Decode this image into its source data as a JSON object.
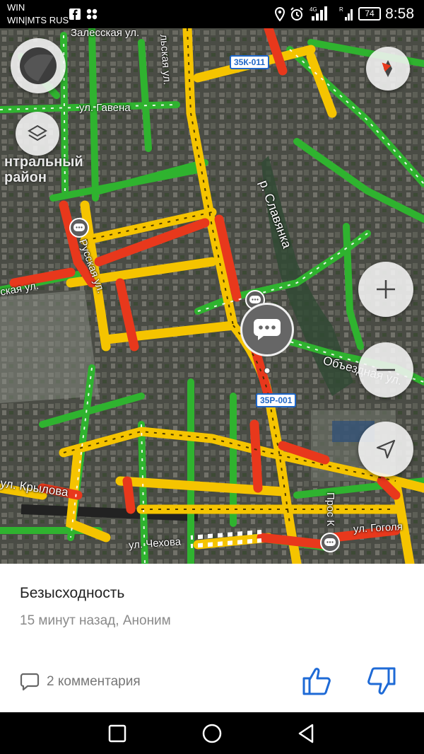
{
  "status_bar": {
    "carrier_line1": "WIN",
    "carrier_line2": "WIN|MTS RUS",
    "time": "8:58",
    "battery": "74",
    "icons": [
      "facebook-icon",
      "grid-icon",
      "location-icon",
      "alarm-icon",
      "signal-icon",
      "wifi-4g-icon",
      "battery-icon"
    ]
  },
  "map": {
    "district": "нтральный\nрайон",
    "road_labels": {
      "zalesskaya": "Залесская ул.",
      "gavena": "ул. Гавена",
      "kaya": "ская ул.",
      "russkaya": "Русская ул.",
      "krylova": "ул. Крылова",
      "chekhova": "ул. Чехова",
      "gogolya": "ул. Гоголя",
      "obezdnaya": "Объездная ул.",
      "slavyanka": "р. Славянка",
      "lskaya": "льская ул.",
      "prosp": "Прос К"
    },
    "shields": {
      "a": "35К-011",
      "b": "35Р-001"
    },
    "controls": [
      "menu-button",
      "layers-button",
      "compass-button",
      "zoom-in-button",
      "zoom-out-button",
      "locate-button"
    ],
    "traffic_colors": {
      "green": "#2fb32f",
      "yellow": "#f5c400",
      "red": "#e8381c"
    }
  },
  "card": {
    "title": "Безысходность",
    "subtitle": "15 минут назад, Аноним",
    "comments": "2 комментария"
  },
  "nav": {
    "buttons": [
      "square-icon",
      "circle-icon",
      "triangle-back-icon"
    ]
  }
}
